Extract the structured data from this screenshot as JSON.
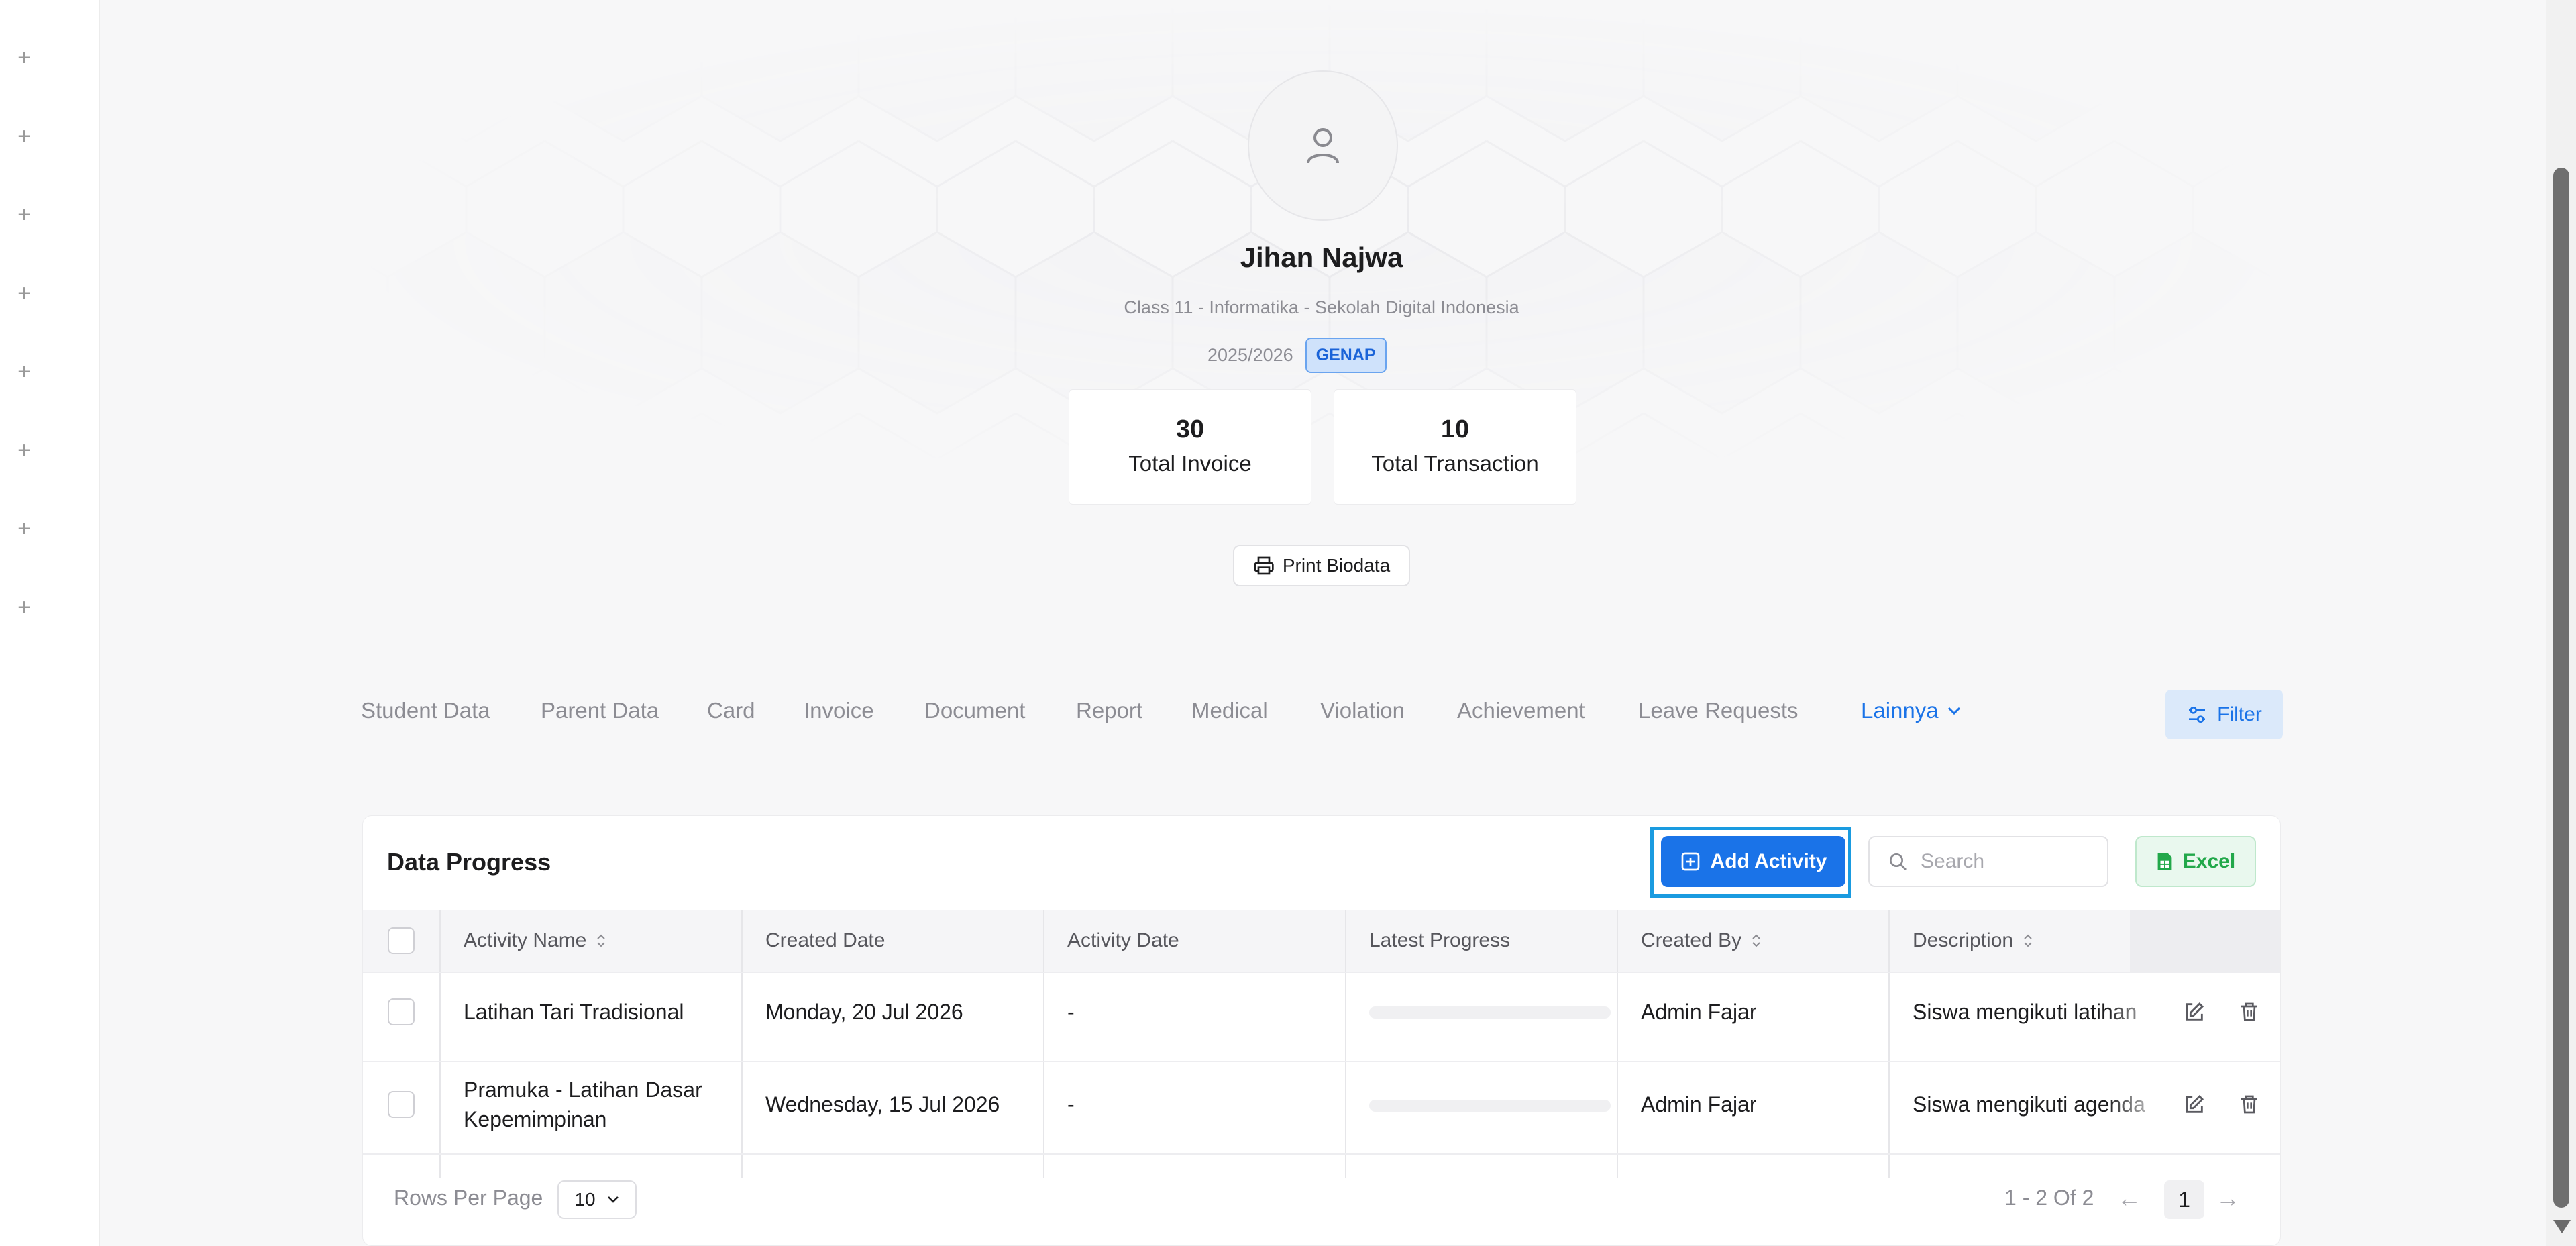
{
  "profile": {
    "name": "Jihan Najwa",
    "subtitle": "Class 11 - Informatika - Sekolah Digital Indonesia",
    "year": "2025/2026",
    "semester_badge": "GENAP",
    "avatar_icon": "user-icon"
  },
  "stats": [
    {
      "value": "30",
      "label": "Total Invoice"
    },
    {
      "value": "10",
      "label": "Total Transaction"
    }
  ],
  "print_button": "Print Biodata",
  "tabs": [
    "Student Data",
    "Parent Data",
    "Card",
    "Invoice",
    "Document",
    "Report",
    "Medical",
    "Violation",
    "Achievement",
    "Leave Requests"
  ],
  "tab_more": "Lainnya",
  "filter_button": "Filter",
  "card": {
    "title": "Data Progress",
    "add_button": "Add Activity",
    "search_placeholder": "Search",
    "excel_button": "Excel"
  },
  "table": {
    "columns": [
      "Activity Name",
      "Created Date",
      "Activity Date",
      "Latest Progress",
      "Created By",
      "Description"
    ],
    "rows": [
      {
        "activity_name_line1": "Latihan Tari Tradisional",
        "activity_name_line2": "",
        "created_date": "Monday, 20 Jul 2026",
        "activity_date": "-",
        "latest_progress": 0,
        "created_by": "Admin Fajar",
        "description": "Siswa mengikuti latihan"
      },
      {
        "activity_name_line1": "Pramuka - Latihan Dasar",
        "activity_name_line2": "Kepemimpinan",
        "created_date": "Wednesday, 15 Jul 2026",
        "activity_date": "-",
        "latest_progress": 0,
        "created_by": "Admin Fajar",
        "description": "Siswa mengikuti agenda"
      }
    ]
  },
  "pagination": {
    "rows_per_page_label": "Rows Per Page",
    "rows_per_page_value": "10",
    "range_text": "1 - 2 Of 2",
    "current_page": "1"
  },
  "colors": {
    "accent": "#1a73e8",
    "highlight_outline": "#1a9be0",
    "excel_green": "#22a84a"
  }
}
